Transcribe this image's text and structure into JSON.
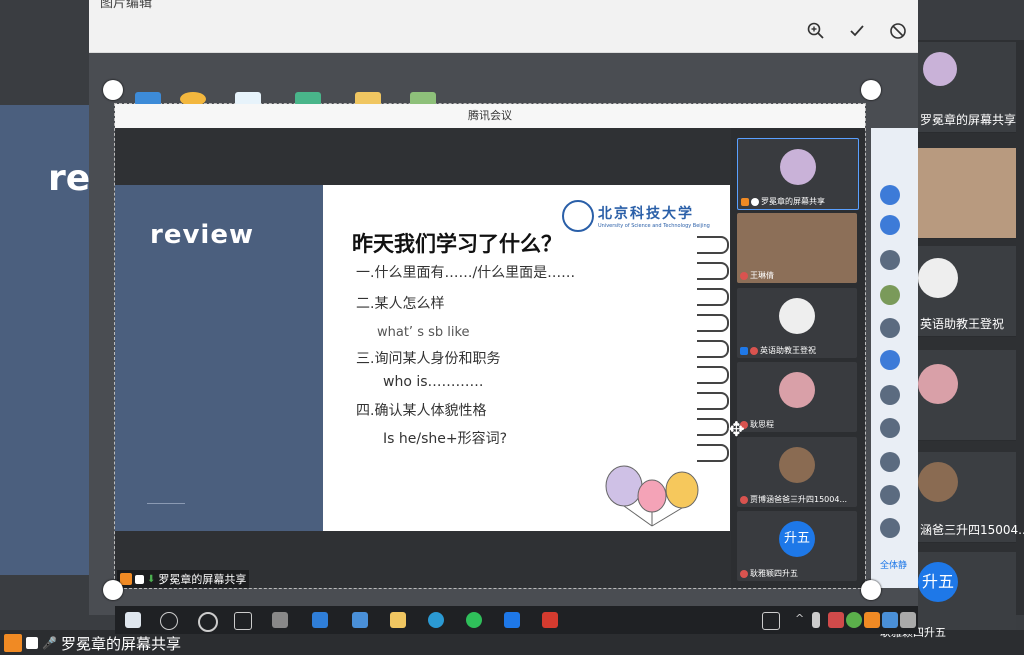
{
  "background_meeting": {
    "slide_word": "re",
    "right_tiles": [
      {
        "label": "罗冕章的屏幕共享"
      },
      {
        "label": ""
      },
      {
        "label": "英语助教王登祝"
      },
      {
        "label": ""
      },
      {
        "label": "涵爸三升四15004..."
      },
      {
        "label": "升五"
      }
    ],
    "bottom_share_label": "罗冕章的屏幕共享",
    "bottom_right_label": "耿雅颖四升五"
  },
  "editor": {
    "title": "图片编辑",
    "zoom_label": "⊕",
    "confirm_label": "✓",
    "cancel_label": "⊘"
  },
  "capture": {
    "app_title": "腾讯会议",
    "slide": {
      "left_word": "review",
      "logo_cn": "北京科技大学",
      "logo_en": "University of Science and Technology Beijing",
      "heading": "昨天我们学习了什么？",
      "lines": [
        "一.什么里面有……/什么里面是……",
        "二.某人怎么样",
        "what’ s  sb like",
        "三.询问某人身份和职务",
        "who is…………",
        "四.确认某人体貌性格",
        "Is he/she+形容词?"
      ]
    },
    "participants": [
      {
        "name": "罗冕章的屏幕共享"
      },
      {
        "name": "王琳倩"
      },
      {
        "name": "英语助教王登祝"
      },
      {
        "name": "耿思程"
      },
      {
        "name": "贾博涵爸爸三升四15004..."
      },
      {
        "name": "耿雅颖四升五",
        "avatar_text": "升五"
      }
    ],
    "share_label": "罗冕章的屏幕共享",
    "strip_button": "全体静"
  },
  "colors": {
    "slide_blue": "#4b5f7e",
    "accent_orange": "#f08a24",
    "avatar_blue": "#1e78e8"
  }
}
